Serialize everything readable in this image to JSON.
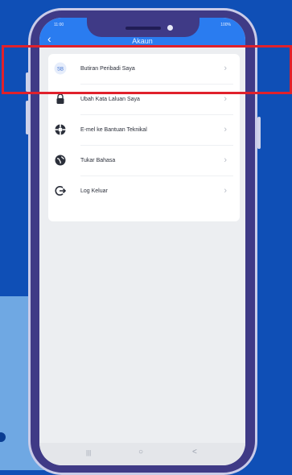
{
  "status_bar": {
    "time": "11:00",
    "battery": "100%"
  },
  "header": {
    "title": "Akaun",
    "back_icon": "chevron-left-icon"
  },
  "menu": [
    {
      "label": "Butiran Peribadi Saya",
      "icon": "id-badge-icon"
    },
    {
      "label": "Ubah Kata Laluan Saya",
      "icon": "lock-icon"
    },
    {
      "label": "E-mel ke Bantuan Teknikal",
      "icon": "lifebuoy-icon"
    },
    {
      "label": "Tukar Bahasa",
      "icon": "globe-icon"
    },
    {
      "label": "Log Keluar",
      "icon": "logout-icon"
    }
  ],
  "nav": {
    "recent": "|||",
    "home": "○",
    "back": "<"
  },
  "colors": {
    "header": "#2a7cf0",
    "highlight": "#e0212b",
    "frame": "#3f3a86",
    "background": "#0f4fb6"
  }
}
